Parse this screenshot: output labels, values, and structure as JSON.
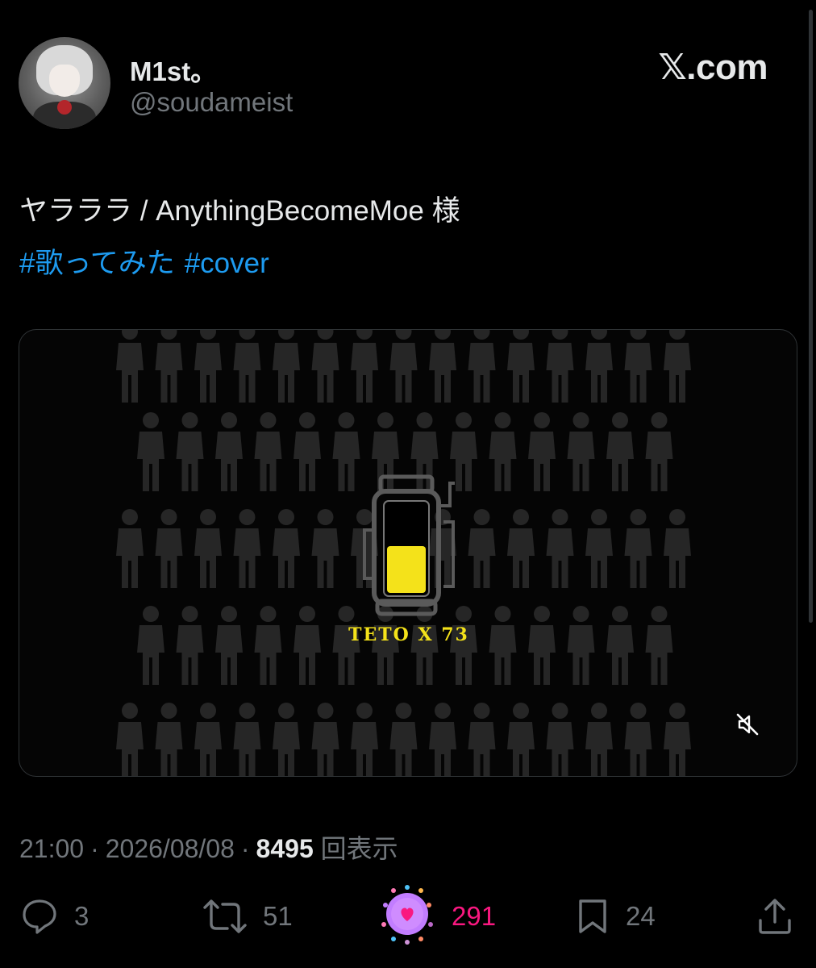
{
  "author": {
    "display_name": "M1st。",
    "handle": "@soudameist"
  },
  "brand": "𝕏.com",
  "post": {
    "text": "ヤラララ / AnythingBecomeMoe 様",
    "hashtags": [
      "#歌ってみた",
      "#cover"
    ]
  },
  "media": {
    "overlay_text": "TETO X 73",
    "accent_color": "#f4e21a"
  },
  "meta": {
    "time": "21:00",
    "separator": "·",
    "date": "2026/08/08",
    "views_count": "8495",
    "views_label": "回表示"
  },
  "actions": {
    "replies": "3",
    "reposts": "51",
    "likes": "291",
    "bookmarks": "24"
  },
  "colors": {
    "background": "#000000",
    "text": "#e7e9ea",
    "secondary": "#71767b",
    "link": "#1d9bf0",
    "like": "#f91880"
  },
  "icons": {
    "reply": "reply-icon",
    "repost": "repost-icon",
    "like": "like-icon",
    "bookmark": "bookmark-icon",
    "share": "share-icon",
    "mute": "mute-icon"
  }
}
